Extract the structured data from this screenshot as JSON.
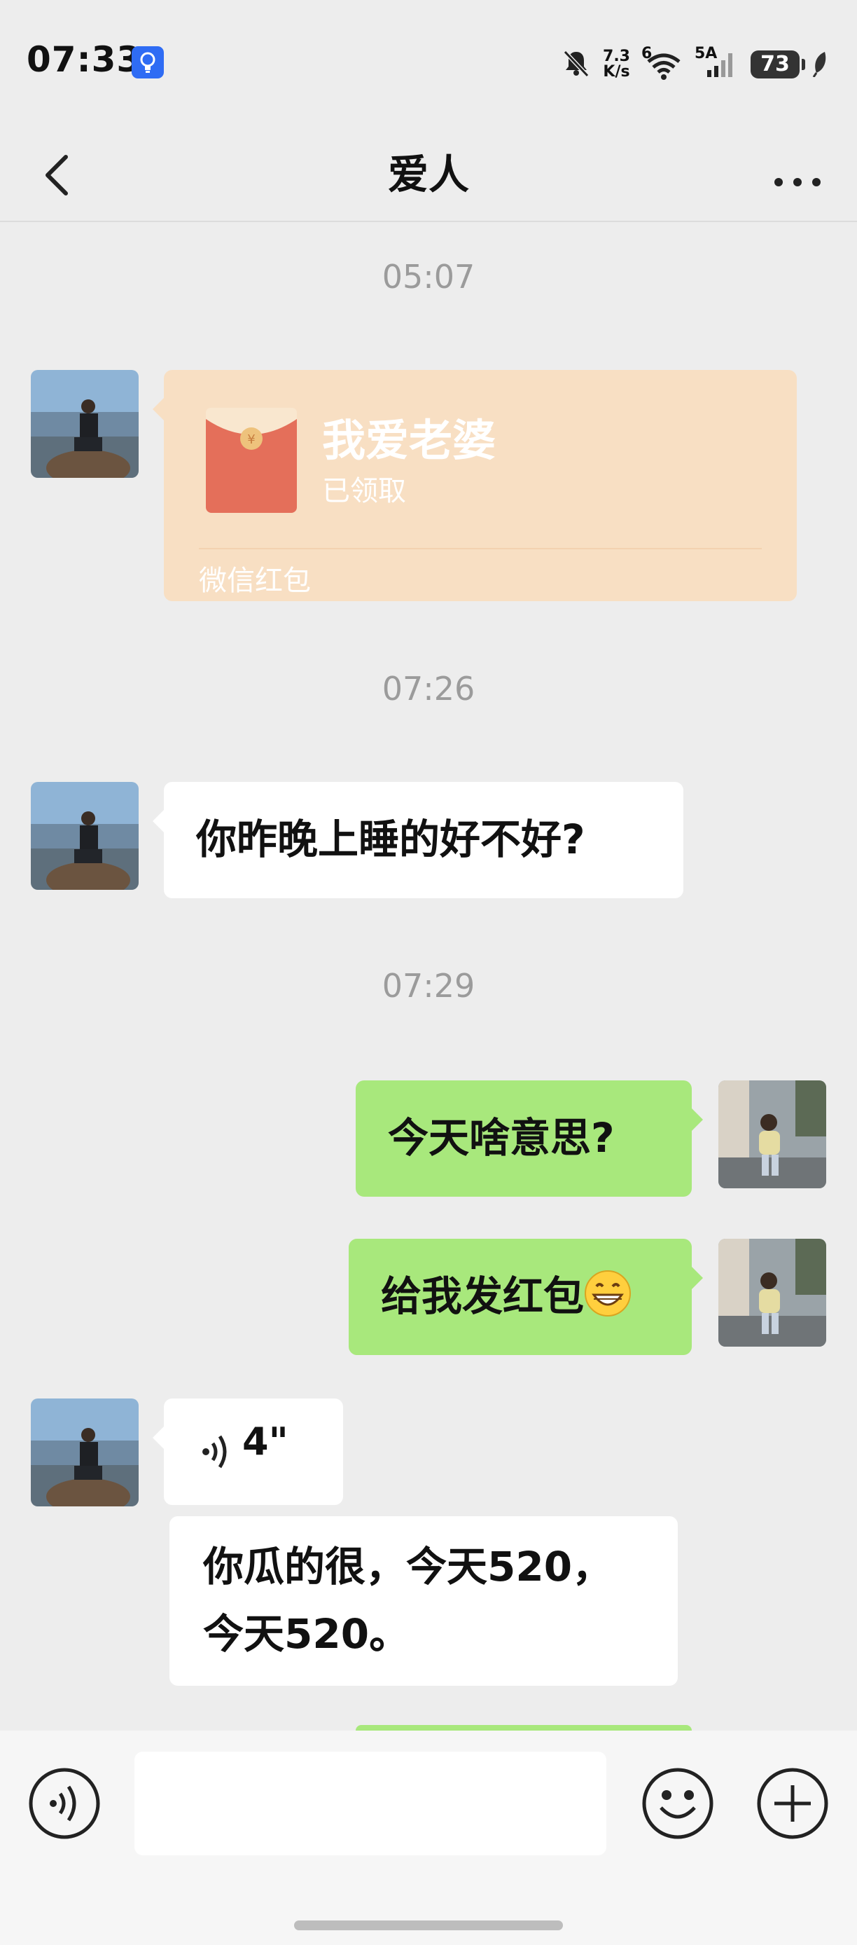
{
  "status_bar": {
    "time": "07:33",
    "net_speed_value": "7.3",
    "net_speed_unit": "K/s",
    "wifi_label": "6",
    "signal_label": "5A",
    "battery": "73"
  },
  "header": {
    "title": "爱人"
  },
  "messages": {
    "ts1": "05:07",
    "red_packet": {
      "title": "我爱老婆",
      "status": "已领取",
      "label": "微信红包"
    },
    "ts2": "07:26",
    "msg1": "你昨晚上睡的好不好?",
    "ts3": "07:29",
    "msg2": "今天啥意思?",
    "msg3": "给我发红包",
    "msg3_emoji": "😁",
    "voice_duration": "4\"",
    "transcript_line1": "你瓜的很，今天520，",
    "transcript_line2": "今天520。"
  },
  "colors": {
    "background": "#ededed",
    "outgoing_bubble": "#a8e87c",
    "incoming_bubble": "#ffffff",
    "red_packet_bg": "#f8dfc3",
    "red_packet_envelope": "#e46f5a",
    "timestamp": "#9b9b9b"
  },
  "icons": {
    "back": "chevron-left-icon",
    "more": "ellipsis-icon",
    "voice_toggle": "voice-icon",
    "emoji": "smiley-icon",
    "plus": "plus-icon"
  }
}
